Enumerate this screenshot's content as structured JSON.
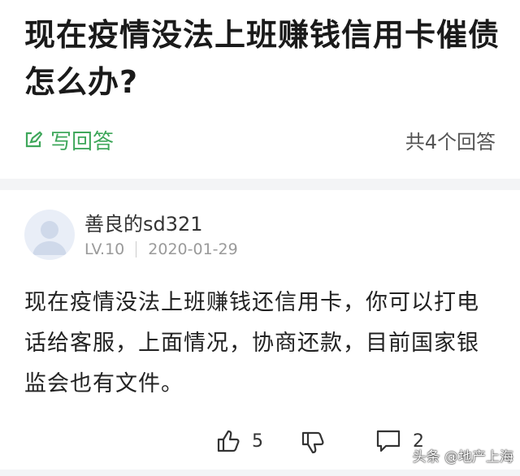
{
  "question": {
    "title": "现在疫情没法上班赚钱信用卡催债怎么办?",
    "write_answer_label": "写回答",
    "answer_count": "共4个回答"
  },
  "answer": {
    "username": "善良的sd321",
    "level": "LV.10",
    "date": "2020-01-29",
    "content": "现在疫情没法上班赚钱还信用卡，你可以打电话给客服，上面情况，协商还款，目前国家银监会也有文件。",
    "likes": "5",
    "comments": "2"
  },
  "watermark": "头条 @地产上海",
  "colors": {
    "accent": "#3fa75b",
    "muted": "#9a9a9a",
    "divider": "#f3f4f6"
  }
}
